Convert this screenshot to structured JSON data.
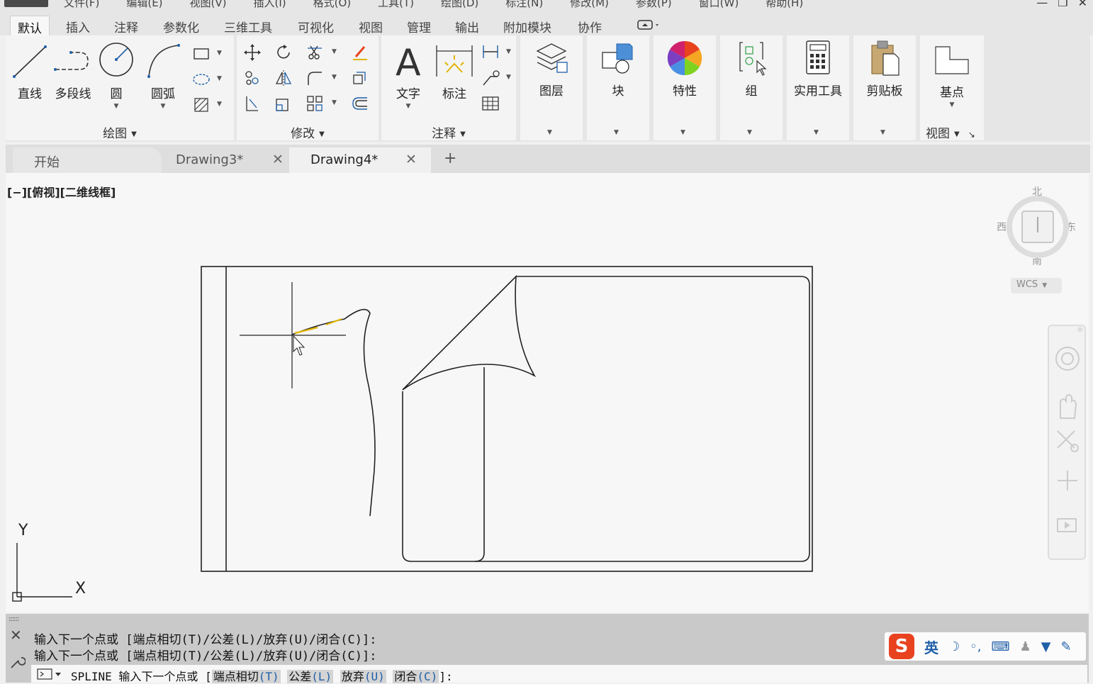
{
  "menubar": {
    "items": [
      "文件(F)",
      "编辑(E)",
      "视图(V)",
      "插入(I)",
      "格式(O)",
      "工具(T)",
      "绘图(D)",
      "标注(N)",
      "修改(M)",
      "参数(P)",
      "窗口(W)",
      "帮助(H)"
    ],
    "win_controls": [
      "—",
      "❐",
      "✕"
    ]
  },
  "ribbon_tabs": [
    "默认",
    "插入",
    "注释",
    "参数化",
    "三维工具",
    "可视化",
    "视图",
    "管理",
    "输出",
    "附加模块",
    "协作"
  ],
  "ribbon": {
    "draw": {
      "title": "绘图",
      "line": "直线",
      "polyline": "多段线",
      "circle": "圆",
      "arc": "圆弧"
    },
    "modify": {
      "title": "修改"
    },
    "annotation": {
      "title": "注释",
      "text": "文字",
      "dimension": "标注"
    },
    "layers": "图层",
    "block": "块",
    "properties": "特性",
    "groups": "组",
    "utilities": "实用工具",
    "clipboard": "剪贴板",
    "view": {
      "title": "视图",
      "base": "基点"
    }
  },
  "doc_tabs": {
    "start": "开始",
    "drawing3": "Drawing3*",
    "drawing4": "Drawing4*",
    "close_glyph": "✕",
    "add_glyph": "+"
  },
  "viewport": {
    "label": "[−][俯视][二维线框]",
    "ucs_x": "X",
    "ucs_y": "Y"
  },
  "viewcube": {
    "north": "北",
    "south": "南",
    "east": "东",
    "west": "西",
    "wcs": "WCS"
  },
  "command": {
    "history": [
      "输入下一个点或 [端点相切(T)/公差(L)/放弃(U)/闭合(C)]:",
      "输入下一个点或 [端点相切(T)/公差(L)/放弃(U)/闭合(C)]:"
    ],
    "prompt_prefix": "SPLINE 输入下一个点或 [",
    "options": [
      {
        "label": "端点相切",
        "key": "(T)"
      },
      {
        "label": "公差",
        "key": "(L)"
      },
      {
        "label": "放弃",
        "key": "(U)"
      },
      {
        "label": "闭合",
        "key": "(C)"
      }
    ],
    "prompt_suffix": "]:"
  },
  "ime": {
    "logo": "S",
    "mode": "英"
  },
  "colors": {
    "accent": "#1f5fa8",
    "ime_red": "#e8421f",
    "yellow_dash": "#e0b400"
  }
}
